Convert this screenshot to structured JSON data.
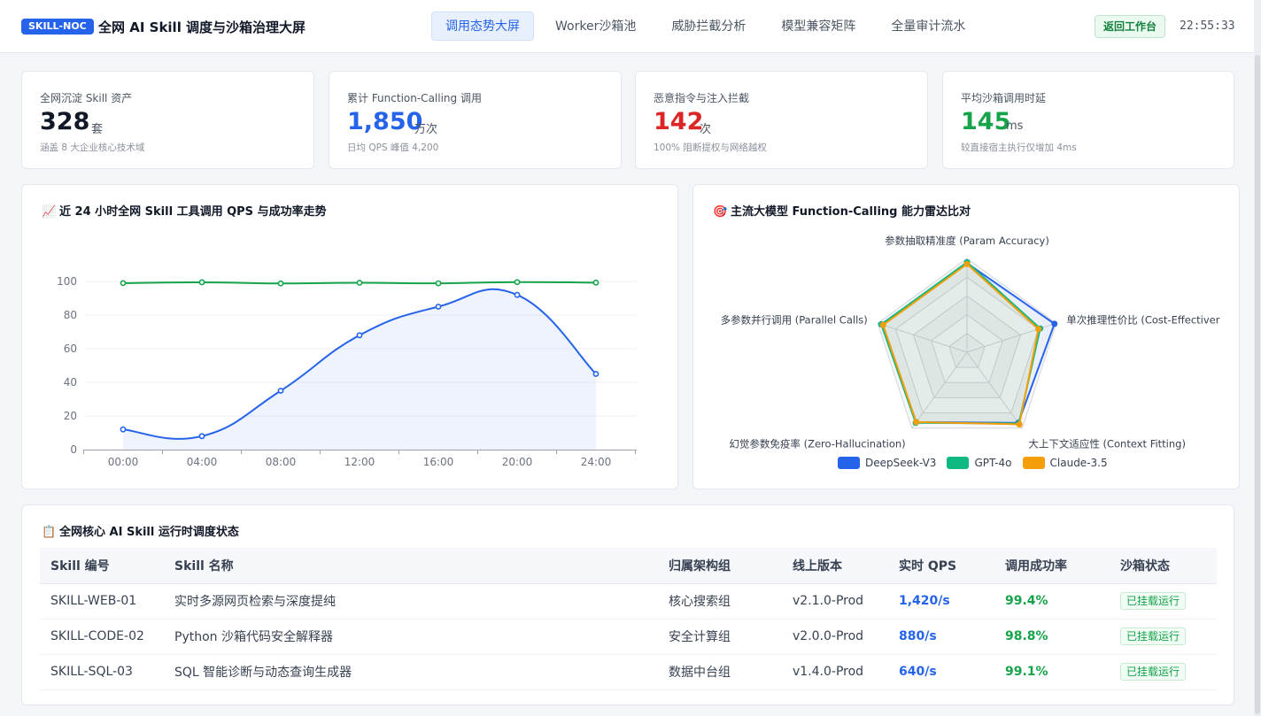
{
  "header": {
    "badge": "SKILL-NOC",
    "title": "全网 AI Skill 调度与沙箱治理大屏",
    "tabs": [
      {
        "label": "调用态势大屏",
        "active": true
      },
      {
        "label": "Worker沙箱池",
        "active": false
      },
      {
        "label": "威胁拦截分析",
        "active": false
      },
      {
        "label": "模型兼容矩阵",
        "active": false
      },
      {
        "label": "全量审计流水",
        "active": false
      }
    ],
    "back_button": "返回工作台",
    "clock": "22:55:33"
  },
  "stats": [
    {
      "label": "全网沉淀 Skill 资产",
      "value": "328",
      "unit": "套",
      "note": "涵盖 8 大企业核心技术域",
      "color": "#111827"
    },
    {
      "label": "累计 Function-Calling 调用",
      "value": "1,850",
      "unit": "万次",
      "note": "日均 QPS 峰值 4,200",
      "color": "#2563eb"
    },
    {
      "label": "恶意指令与注入拦截",
      "value": "142",
      "unit": "次",
      "note": "100% 阻断提权与网络越权",
      "color": "#dc2626"
    },
    {
      "label": "平均沙箱调用时延",
      "value": "145",
      "unit": "ms",
      "note": "较直接宿主执行仅增加 4ms",
      "color": "#16a34a"
    }
  ],
  "trend_panel": {
    "icon": "📈",
    "title": "近 24 小时全网 Skill 工具调用 QPS 与成功率走势"
  },
  "radar_panel": {
    "icon": "🎯",
    "title": "主流大模型 Function-Calling 能力雷达比对"
  },
  "table_panel": {
    "icon": "📋",
    "title": "全网核心 AI Skill 运行时调度状态",
    "columns": [
      "Skill 编号",
      "Skill 名称",
      "归属架构组",
      "线上版本",
      "实时 QPS",
      "调用成功率",
      "沙箱状态"
    ],
    "rows": [
      {
        "id": "SKILL-WEB-01",
        "name": "实时多源网页检索与深度提纯",
        "group": "核心搜索组",
        "version": "v2.1.0-Prod",
        "qps": "1,420/s",
        "rate": "99.4%",
        "status": "已挂载运行"
      },
      {
        "id": "SKILL-CODE-02",
        "name": "Python 沙箱代码安全解释器",
        "group": "安全计算组",
        "version": "v2.0.0-Prod",
        "qps": "880/s",
        "rate": "98.8%",
        "status": "已挂载运行"
      },
      {
        "id": "SKILL-SQL-03",
        "name": "SQL 智能诊断与动态查询生成器",
        "group": "数据中台组",
        "version": "v1.4.0-Prod",
        "qps": "640/s",
        "rate": "99.1%",
        "status": "已挂载运行"
      }
    ]
  },
  "chart_data": [
    {
      "type": "line",
      "x": [
        "00:00",
        "04:00",
        "08:00",
        "12:00",
        "16:00",
        "20:00",
        "24:00"
      ],
      "ylim": [
        0,
        100
      ],
      "yticks": [
        0,
        20,
        40,
        60,
        80,
        100
      ],
      "grid": true,
      "series": [
        {
          "values": [
            12,
            8,
            35,
            68,
            85,
            92,
            45
          ],
          "color": "#2563eb",
          "area": true
        },
        {
          "values": [
            99,
            99.5,
            98.8,
            99.2,
            98.9,
            99.6,
            99.3
          ],
          "color": "#16a34a",
          "area": false
        }
      ]
    },
    {
      "type": "radar",
      "axes": [
        "参数抽取精准度 (Param Accuracy)",
        "单次推理性价比 (Cost-Effectiver",
        "大上下文适应性 (Context Fitting)",
        "幻觉参数免疫率 (Zero-Hallucination)",
        "多参数并行调用 (Parallel Calls)"
      ],
      "max": 100,
      "legend_position": "bottom",
      "series": [
        {
          "name": "DeepSeek-V3",
          "color": "#2563eb",
          "values": [
            95,
            98,
            93,
            92,
            96
          ]
        },
        {
          "name": "GPT-4o",
          "color": "#10b981",
          "values": [
            96,
            82,
            94,
            93,
            96
          ]
        },
        {
          "name": "Claude-3.5",
          "color": "#f59e0b",
          "values": [
            94,
            80,
            95,
            92,
            94
          ]
        }
      ]
    }
  ]
}
